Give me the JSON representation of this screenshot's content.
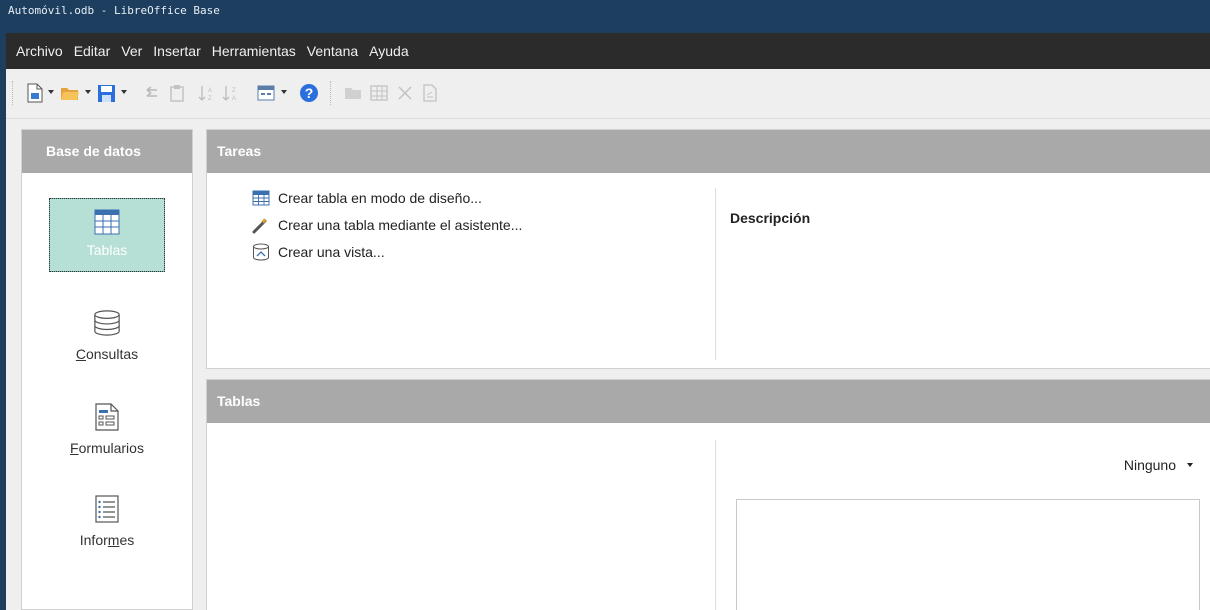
{
  "window": {
    "title": "Automóvil.odb - LibreOffice Base"
  },
  "menu": [
    "Archivo",
    "Editar",
    "Ver",
    "Insertar",
    "Herramientas",
    "Ventana",
    "Ayuda"
  ],
  "toolbar": {
    "icons": [
      "new-document-icon",
      "open-folder-icon",
      "save-icon",
      "undo-icon",
      "paste-icon",
      "sort-ascending-icon",
      "sort-descending-icon",
      "form-view-icon",
      "help-icon",
      "open-db-object-icon",
      "edit-table-icon",
      "delete-icon",
      "rename-icon"
    ]
  },
  "sidebar": {
    "header": "Base de datos",
    "items": [
      {
        "label": "Tablas",
        "icon": "table-icon",
        "selected": true
      },
      {
        "label": "Consultas",
        "icon": "query-icon",
        "selected": false
      },
      {
        "label": "Formularios",
        "icon": "form-icon",
        "selected": false
      },
      {
        "label": "Informes",
        "icon": "report-icon",
        "selected": false
      }
    ]
  },
  "tasks": {
    "header": "Tareas",
    "items": [
      {
        "label": "Crear tabla en modo de diseño...",
        "icon": "table-design-icon"
      },
      {
        "label": "Crear una tabla mediante el asistente...",
        "icon": "wizard-icon"
      },
      {
        "label": "Crear una vista...",
        "icon": "view-icon"
      }
    ],
    "description_label": "Descripción"
  },
  "tables": {
    "header": "Tablas",
    "preview_mode": "Ninguno"
  },
  "colors": {
    "titlebar": "#1d3e5e",
    "menubar": "#2b2b2b",
    "panel_header": "#a9a9a9",
    "selection": "#b6dfd6"
  }
}
